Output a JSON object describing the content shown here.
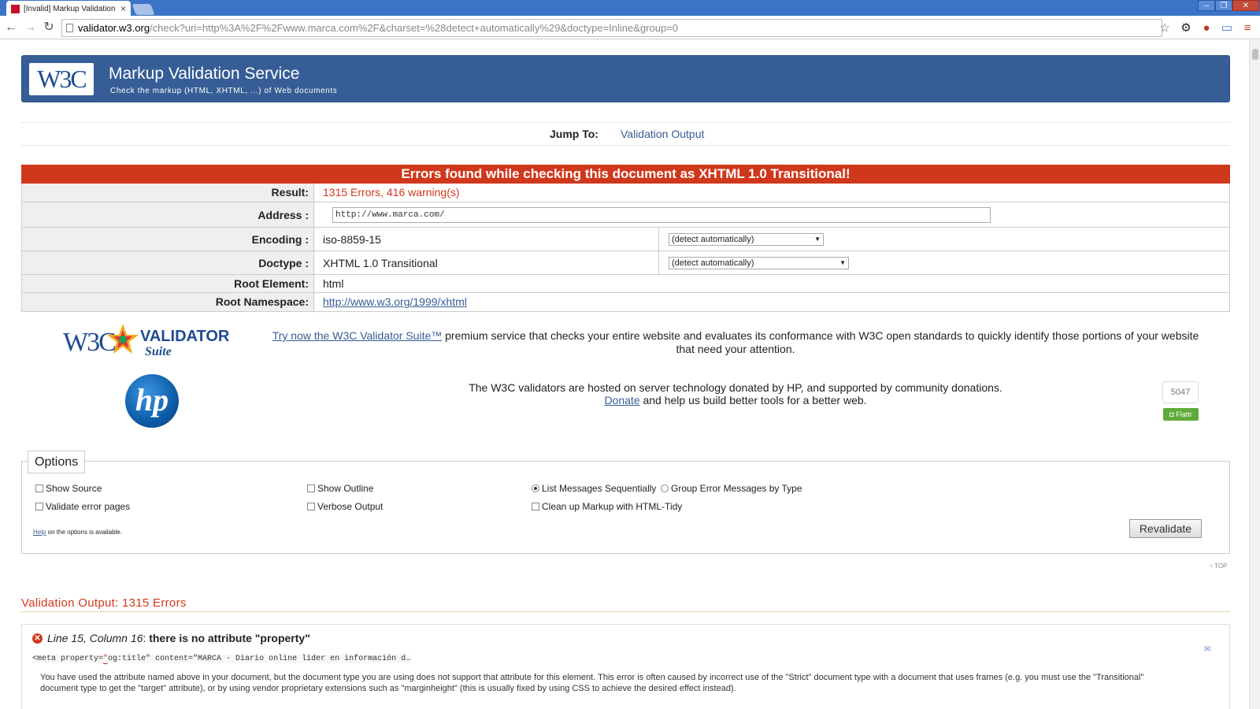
{
  "browser": {
    "tab_title": "[Invalid] Markup Validation o",
    "tab_close": "×",
    "url_host": "validator.w3.org",
    "url_path": "/check?uri=http%3A%2F%2Fwww.marca.com%2F&charset=%28detect+automatically%29&doctype=Inline&group=0"
  },
  "banner": {
    "logo_text": "W3C",
    "title": "Markup Validation Service",
    "subtitle": "Check the markup (HTML, XHTML, ...) of Web documents"
  },
  "jump": {
    "label": "Jump To:",
    "link": "Validation Output"
  },
  "error_banner": "Errors found while checking this document as XHTML 1.0 Transitional!",
  "results": {
    "result_label": "Result:",
    "result_value": "1315 Errors, 416 warning(s)",
    "address_label": "Address :",
    "address_value": "http://www.marca.com/",
    "encoding_label": "Encoding :",
    "encoding_value": "iso-8859-15",
    "encoding_select": "(detect automatically)",
    "doctype_label": "Doctype :",
    "doctype_value": "XHTML 1.0 Transitional",
    "doctype_select": "(detect automatically)",
    "root_element_label": "Root Element:",
    "root_element_value": "html",
    "root_ns_label": "Root Namespace:",
    "root_ns_value": "http://www.w3.org/1999/xhtml"
  },
  "suite": {
    "logo_w3c": "W3C",
    "logo_validator": "VALIDATOR",
    "logo_suite": "Suite",
    "link": "Try now the W3C Validator Suite™",
    "text": " premium service that checks your entire website and evaluates its conformance with W3C open standards to quickly identify those portions of your website that need your attention."
  },
  "hp": {
    "logo": "hp",
    "line1": "The W3C validators are hosted on server technology donated by HP, and supported by community donations.",
    "donate_link": "Donate",
    "line2": " and help us build better tools for a better web.",
    "flattr_count": "5047",
    "flattr_label": "Flattr"
  },
  "options": {
    "legend": "Options",
    "show_source": "Show Source",
    "show_outline": "Show Outline",
    "list_sequential": "List Messages Sequentially",
    "group_by_type": "Group Error Messages by Type",
    "validate_error_pages": "Validate error pages",
    "verbose_output": "Verbose Output",
    "cleanup_tidy": "Clean up Markup with HTML-Tidy",
    "help_link": "Help",
    "help_text": " on the options is available.",
    "revalidate": "Revalidate"
  },
  "top_link": "↑ TOP",
  "output": {
    "heading": "Validation Output: 1315 Errors",
    "msg_location": "Line 15, Column 16",
    "msg_sep": ": ",
    "msg_title": "there is no attribute \"property\"",
    "code_before": "<meta property=",
    "code_hl": "\"",
    "code_after": "og:title\" content=\"MARCA - Diario online líder en información d…",
    "explanation": "You have used the attribute named above in your document, but the document type you are using does not support that attribute for this element. This error is often caused by incorrect use of the \"Strict\" document type with a document that uses frames (e.g. you must use the \"Transitional\" document type to get the \"target\" attribute), or by using vendor proprietary extensions such as \"marginheight\" (this is usually fixed by using CSS to achieve the desired effect instead)."
  },
  "colors": {
    "banner": "#365d95",
    "error": "#d0381c",
    "browser_frame": "#3b74c7"
  }
}
